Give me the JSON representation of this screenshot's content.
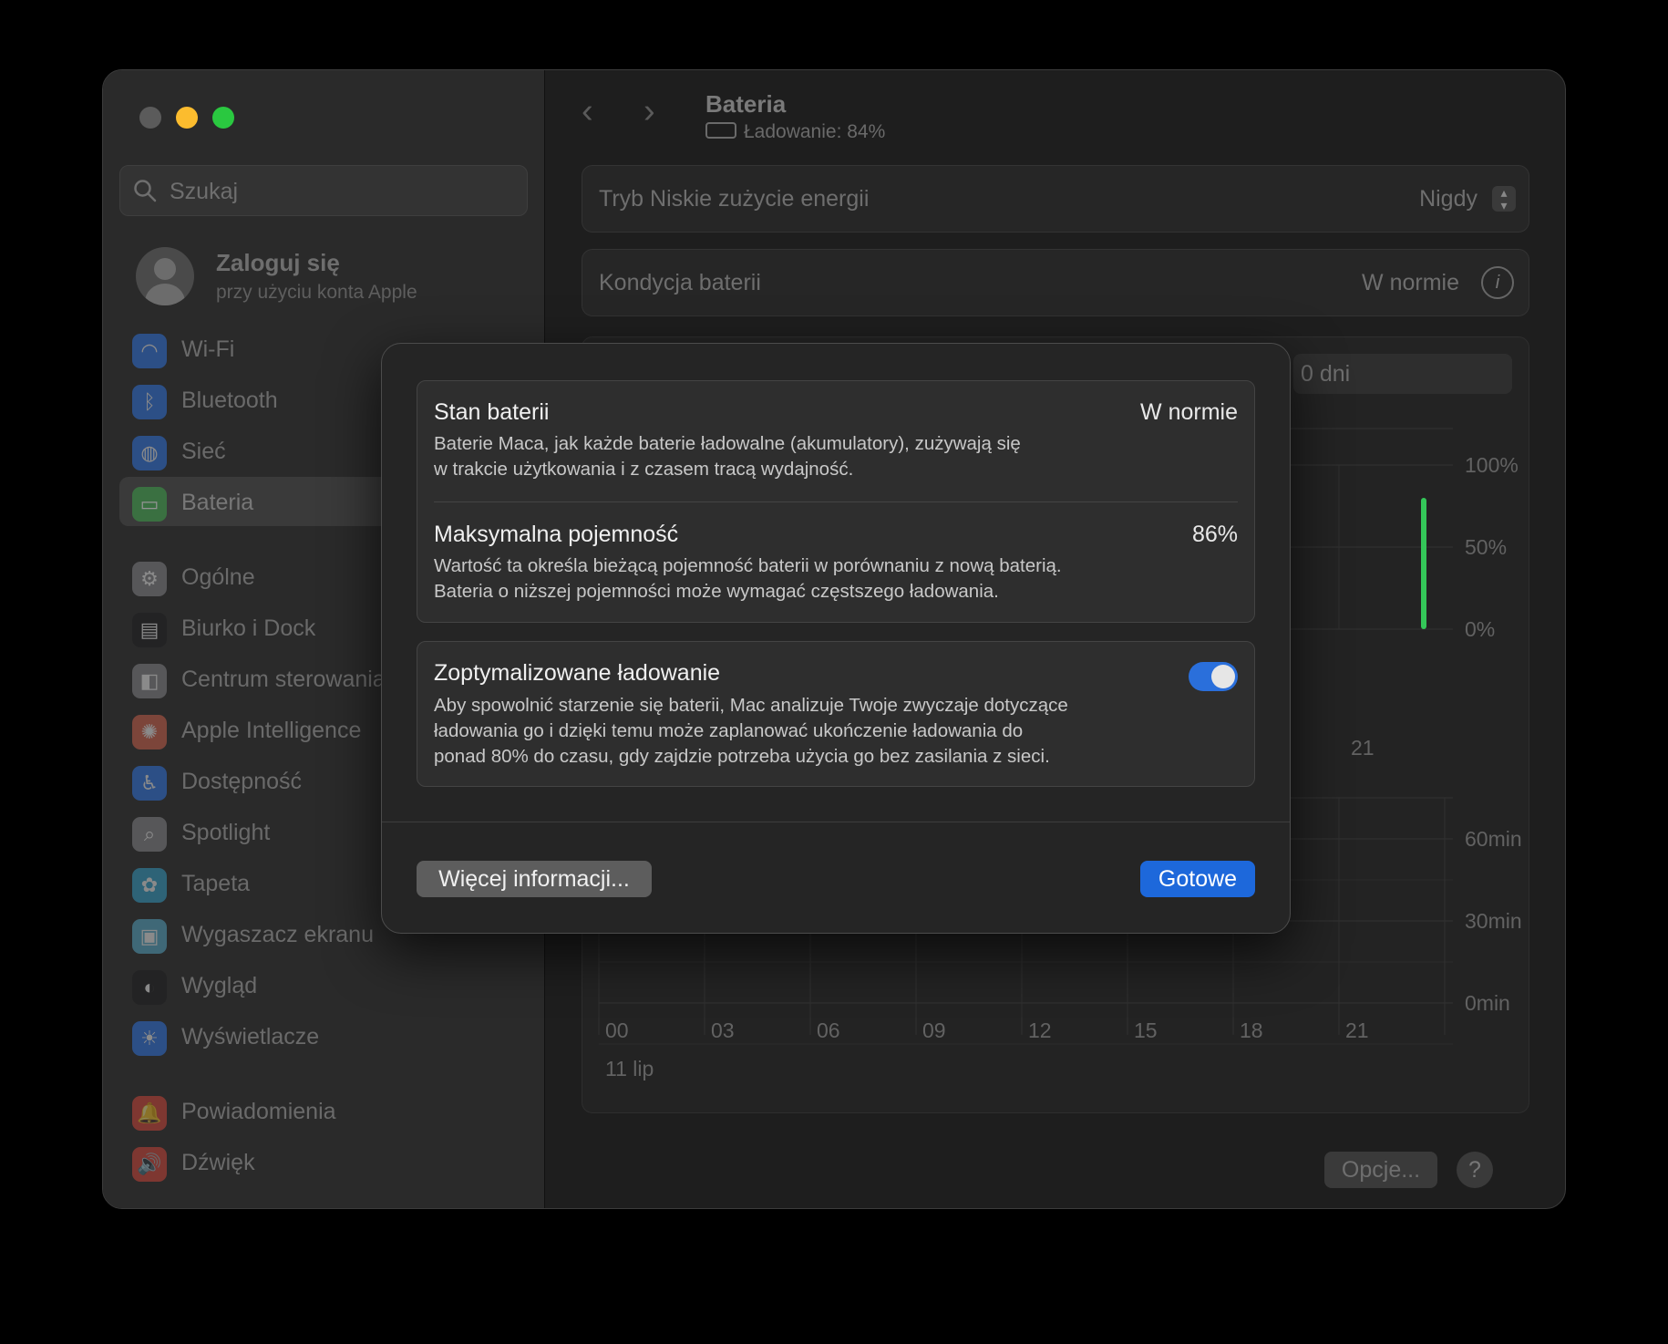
{
  "window": {
    "title": "Bateria",
    "status": "Ładowanie: 84%"
  },
  "sidebar": {
    "search_placeholder": "Szukaj",
    "account": {
      "title": "Zaloguj się",
      "subtitle": "przy użyciu konta Apple"
    },
    "items": [
      {
        "label": "Wi-Fi",
        "icon": "wifi-icon",
        "color": "#2f7cf6"
      },
      {
        "label": "Bluetooth",
        "icon": "bluetooth-icon",
        "color": "#2f7cf6"
      },
      {
        "label": "Sieć",
        "icon": "globe-icon",
        "color": "#2f7cf6"
      },
      {
        "label": "Bateria",
        "icon": "battery-icon",
        "color": "#3ab34a"
      },
      {
        "label": "Ogólne",
        "icon": "gear-icon",
        "color": "#8e8e93"
      },
      {
        "label": "Biurko i Dock",
        "icon": "dock-icon",
        "color": "#1c1c1e"
      },
      {
        "label": "Centrum sterowania",
        "icon": "control-center-icon",
        "color": "#8e8e93"
      },
      {
        "label": "Apple Intelligence",
        "icon": "apple-intelligence-icon",
        "color": "#e0664f"
      },
      {
        "label": "Dostępność",
        "icon": "accessibility-icon",
        "color": "#2f7cf6"
      },
      {
        "label": "Spotlight",
        "icon": "spotlight-icon",
        "color": "#8e8e93"
      },
      {
        "label": "Tapeta",
        "icon": "wallpaper-icon",
        "color": "#34a8d6"
      },
      {
        "label": "Wygaszacz ekranu",
        "icon": "screensaver-icon",
        "color": "#5ab4d6"
      },
      {
        "label": "Wygląd",
        "icon": "appearance-icon",
        "color": "#1c1c1e"
      },
      {
        "label": "Wyświetlacze",
        "icon": "display-icon",
        "color": "#2f7cf6"
      },
      {
        "label": "Powiadomienia",
        "icon": "bell-icon",
        "color": "#e5483b"
      },
      {
        "label": "Dźwięk",
        "icon": "speaker-icon",
        "color": "#e5483b"
      }
    ]
  },
  "settings": {
    "low_power": {
      "label": "Tryb Niskie zużycie energii",
      "value": "Nigdy"
    },
    "health": {
      "label": "Kondycja baterii",
      "value": "W normie"
    },
    "period_tab": "0 dni"
  },
  "chart_data": [
    {
      "type": "bar",
      "title": "",
      "y_ticks": [
        "100%",
        "50%",
        "0%"
      ],
      "x_tick_visible": "21",
      "values_note": "",
      "bar_color": "#34c759",
      "series": [
        {
          "values": [
            80
          ]
        }
      ]
    },
    {
      "type": "bar",
      "y_ticks": [
        "60min",
        "30min",
        "0min"
      ],
      "x_ticks": [
        "00",
        "03",
        "06",
        "09",
        "12",
        "15",
        "18",
        "21"
      ],
      "x_date": "11 lip"
    }
  ],
  "footer": {
    "options_label": "Opcje...",
    "help_label": "?"
  },
  "dialog": {
    "battery_state": {
      "title": "Stan baterii",
      "value": "W normie",
      "desc1": "Baterie Maca, jak każde baterie ładowalne (akumulatory), zużywają się",
      "desc2": "w trakcie użytkowania i z czasem tracą wydajność."
    },
    "max_capacity": {
      "title": "Maksymalna pojemność",
      "value": "86%",
      "desc1": "Wartość ta określa bieżącą pojemność baterii w porównaniu z nową baterią.",
      "desc2": "Bateria o niższej pojemności może wymagać częstszego ładowania."
    },
    "optimized": {
      "title": "Zoptymalizowane ładowanie",
      "enabled": true,
      "desc1": "Aby spowolnić starzenie się baterii, Mac analizuje Twoje zwyczaje dotyczące",
      "desc2": "ładowania go i dzięki temu może zaplanować ukończenie ładowania do",
      "desc3": "ponad 80% do czasu, gdy zajdzie potrzeba użycia go bez zasilania z sieci."
    },
    "more_info_label": "Więcej informacji...",
    "done_label": "Gotowe",
    "accent_color": "#1d68db"
  }
}
